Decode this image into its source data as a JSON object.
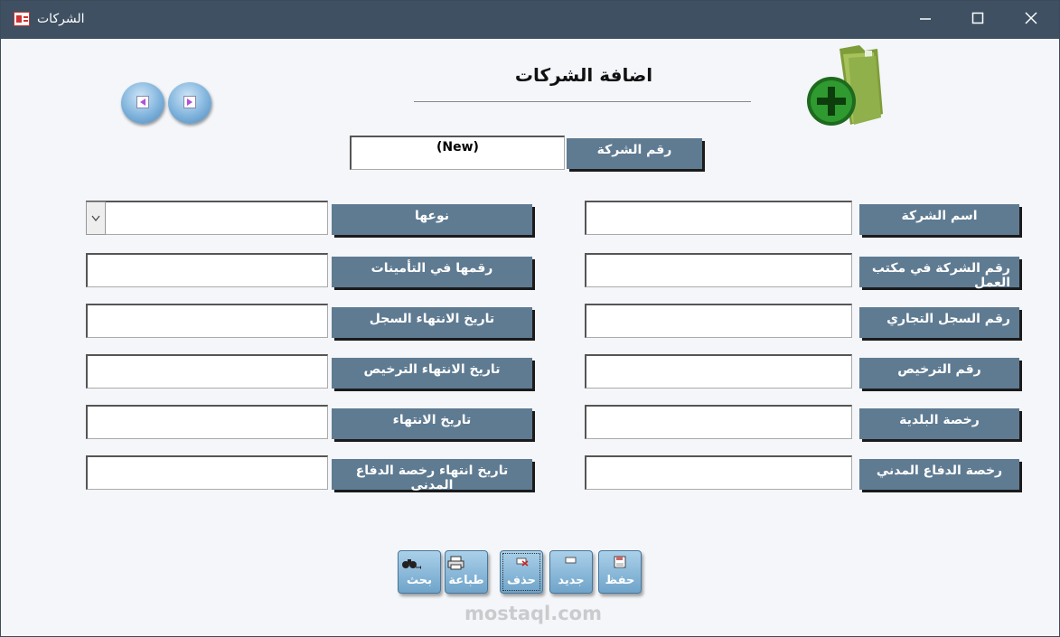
{
  "window": {
    "title": "الشركات",
    "icon": "table-form-icon"
  },
  "header": {
    "title": "اضافة الشركات"
  },
  "company_no": {
    "label": "رقم الشركة",
    "value": "(New)"
  },
  "left_column": [
    {
      "label": "نوعها",
      "value": ""
    },
    {
      "label": "رقمها في التأمينات",
      "value": ""
    },
    {
      "label": "تاريخ الانتهاء السجل",
      "value": ""
    },
    {
      "label": "تاريخ الانتهاء الترخيص",
      "value": ""
    },
    {
      "label": "تاريخ الانتهاء",
      "value": ""
    },
    {
      "label": "تاريخ انتهاء رخصة الدفاع المدنى",
      "value": ""
    }
  ],
  "right_column": [
    {
      "label": "اسم  الشركة",
      "value": ""
    },
    {
      "label": "رقم الشركة في مكتب العمل",
      "value": ""
    },
    {
      "label": "رقم السجل التجاري",
      "value": ""
    },
    {
      "label": "رقم الترخيص",
      "value": ""
    },
    {
      "label": "رخصة البلدية",
      "value": ""
    },
    {
      "label": "رخصة الدفاع المدني",
      "value": ""
    }
  ],
  "toolbar": {
    "search": "بحث",
    "print": "طباعة",
    "delete": "حذف",
    "new": "جديد",
    "save": "حفظ"
  },
  "watermark": "mostaql.com",
  "colors": {
    "titlebar": "#3e5062",
    "label_bg": "#5f7b92",
    "button_bg": "#6fa4c9",
    "folder_green": "#8fb04a"
  }
}
